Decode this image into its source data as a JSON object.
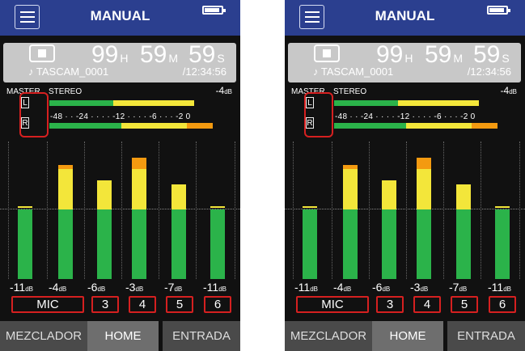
{
  "header": {
    "title": "MANUAL",
    "menu_icon": "menu-icon",
    "battery_icon": "battery-icon",
    "battery_level": 0.9
  },
  "counter": {
    "stop_icon": "stop-icon",
    "hours": "99",
    "hours_unit": "H",
    "minutes": "59",
    "minutes_unit": "M",
    "seconds": "59",
    "seconds_unit": "S",
    "file_name": "♪ TASCAM_0001",
    "total_time": "/12:34:56"
  },
  "master": {
    "label": "MASTER",
    "mode": "STEREO",
    "peak_value": "-4",
    "peak_unit": "dB",
    "channel_l": "L",
    "channel_r": "R",
    "scale": "-48 · · -24 · · · · -12 · · · · -6 · · · -2 0",
    "meter_l_level": 0.78,
    "meter_r_level": 0.88
  },
  "channels": [
    {
      "level": "-11",
      "unit": "dB",
      "label": "MIC",
      "meter": 0.52
    },
    {
      "level": "-4",
      "unit": "dB",
      "label": "3",
      "meter": 0.83
    },
    {
      "level": "-6",
      "unit": "dB",
      "label": "4",
      "meter": 0.72
    },
    {
      "level": "-3",
      "unit": "dB",
      "label": "5",
      "meter": 0.88
    },
    {
      "level": "-7",
      "unit": "dB",
      "label": "6",
      "meter": 0.69
    },
    {
      "level": "-11",
      "unit": "dB",
      "label": "",
      "meter": 0.52
    }
  ],
  "tabs": [
    {
      "label": "MEZCLADOR",
      "active": false
    },
    {
      "label": "HOME",
      "active": true
    },
    {
      "label": "ENTRADA",
      "active": false
    }
  ],
  "colors": {
    "header": "#2b3f8f",
    "green": "#2bb34a",
    "yellow": "#f3e63a",
    "orange": "#f39a10",
    "highlight": "#d62020"
  }
}
